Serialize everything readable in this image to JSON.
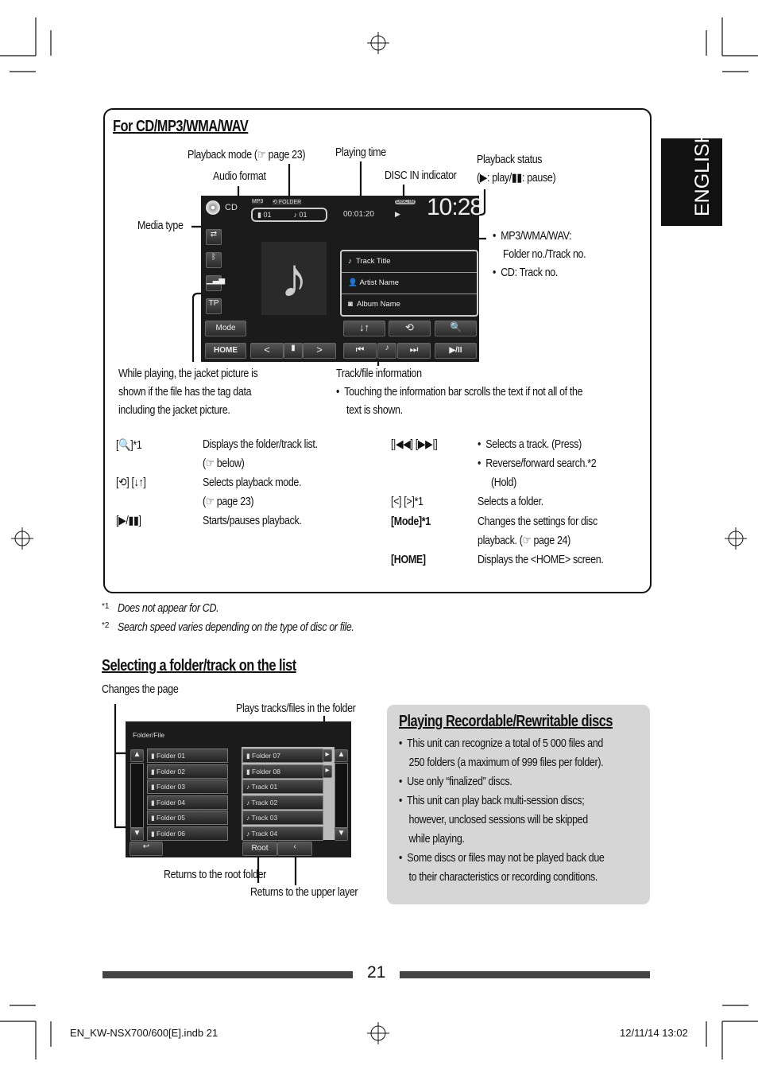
{
  "side_tab": "ENGLISH",
  "section1": {
    "title": "For CD/MP3/WMA/WAV",
    "callouts": {
      "playback_mode": "Playback mode (☞ page 23)",
      "audio_format": "Audio format",
      "playing_time": "Playing time",
      "disc_in": "DISC IN indicator",
      "playback_status_1": "Playback status",
      "playback_status_2": "(▶: play/▮▮: pause)",
      "media_type": "Media type",
      "folder_track_1": "MP3/WMA/WAV:",
      "folder_track_2": "Folder no./Track no.",
      "folder_track_3": "CD: Track no.",
      "jacket_1": "While playing, the jacket picture is",
      "jacket_2": "shown if the file has the tag data",
      "jacket_3": "including the jacket picture.",
      "trackinfo_title": "Track/file information",
      "trackinfo_1": "Touching the information bar scrolls the text if not all of the",
      "trackinfo_2": "text is shown."
    },
    "screen": {
      "media": "CD",
      "format": "MP3",
      "mode": "FOLDER",
      "folder_no": "01",
      "track_no": "01",
      "time": "00:01:20",
      "disc_in": "DISC IN",
      "clock": "10:28",
      "track_title": "Track Title",
      "artist": "Artist Name",
      "album": "Album Name",
      "tp": "TP",
      "mode_btn": "Mode",
      "home_btn": "HOME",
      "playpause": "▶/II"
    },
    "legend": [
      {
        "key": "[🔍]*1",
        "desc": [
          "Displays the folder/track list.",
          "(☞ below)"
        ]
      },
      {
        "key": "[⟲] [↓↑]",
        "desc": [
          "Selects playback mode.",
          "(☞ page 23)"
        ]
      },
      {
        "key": "[▶/▮▮]",
        "desc": [
          "Starts/pauses playback."
        ]
      },
      {
        "key": "[|◀◀] [▶▶|]",
        "desc": [
          "Selects a track. (Press)",
          "Reverse/forward search.*2",
          "(Hold)"
        ]
      },
      {
        "key": "[<] [>]*1",
        "desc": [
          "Selects a folder."
        ]
      },
      {
        "key": "[Mode]*1",
        "desc": [
          "Changes the settings for disc",
          "playback. (☞ page 24)"
        ]
      },
      {
        "key": "[HOME]",
        "desc": [
          "Displays the <HOME> screen."
        ]
      }
    ]
  },
  "footnotes": [
    {
      "mark": "*1",
      "text": "Does not appear for CD."
    },
    {
      "mark": "*2",
      "text": "Search speed varies depending on the type of disc or file."
    }
  ],
  "section2": {
    "title": "Selecting a folder/track on the list",
    "callouts": {
      "changes_page": "Changes the page",
      "plays_tracks": "Plays tracks/files in the folder",
      "root": "Returns to the root folder",
      "upper": "Returns to the upper layer"
    },
    "screen": {
      "header": "Folder/File",
      "left": [
        "Folder 01",
        "Folder 02",
        "Folder 03",
        "Folder 04",
        "Folder 05",
        "Folder 06"
      ],
      "right": [
        "Folder 07",
        "Folder 08",
        "Track 01",
        "Track 02",
        "Track 03",
        "Track 04"
      ],
      "root": "Root"
    }
  },
  "section3": {
    "title": "Playing Recordable/Rewritable discs",
    "lines": [
      "•  This unit can recognize a total of 5 000 files and",
      "    250 folders (a maximum of 999 files per folder).",
      "•  Use only “finalized” discs.",
      "•  This unit can play back multi-session discs;",
      "    however, unclosed sessions will be skipped",
      "    while playing.",
      "•  Some discs or files may not be played back due",
      "    to their characteristics or recording conditions."
    ]
  },
  "page_number": "21",
  "print_footer": {
    "file": "EN_KW-NSX700/600[E].indb   21",
    "date": "12/11/14   13:02"
  }
}
